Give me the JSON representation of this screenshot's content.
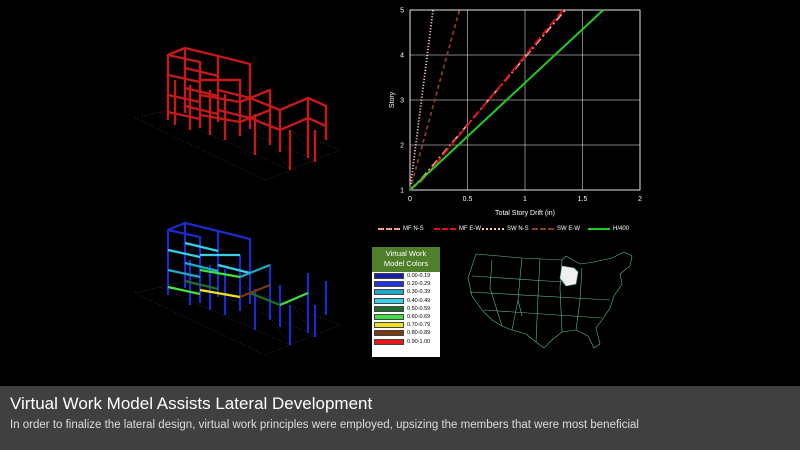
{
  "slide": {
    "title": "Virtual Work Model Assists Lateral Development",
    "subtitle": "In order to finalize the lateral design, virtual work principles were employed, upsizing the members that were most beneficial"
  },
  "chart_data": {
    "type": "line",
    "title": "",
    "xlabel": "Total Story Drift (in)",
    "ylabel": "Story",
    "xlim": [
      0,
      2
    ],
    "ylim": [
      1,
      5
    ],
    "xticks": [
      "0",
      "0.5",
      "1",
      "1.5",
      "2"
    ],
    "yticks": [
      "1",
      "2",
      "3",
      "4",
      "5"
    ],
    "grid": true,
    "legend_position": "bottom",
    "series": [
      {
        "name": "MF N-S",
        "color": "#f4a0a0",
        "style": "dashdot",
        "points": [
          [
            0,
            1
          ],
          [
            0.1,
            1.25
          ],
          [
            1.35,
            5
          ]
        ]
      },
      {
        "name": "MF E-W",
        "color": "#e01010",
        "style": "longdash",
        "points": [
          [
            0,
            1
          ],
          [
            0.1,
            1.2
          ],
          [
            1.33,
            5
          ]
        ]
      },
      {
        "name": "SW N-S",
        "color": "#f6c8b8",
        "style": "dotted",
        "points": [
          [
            0,
            1
          ],
          [
            0.2,
            5
          ]
        ]
      },
      {
        "name": "SW E-W",
        "color": "#8a3a2a",
        "style": "dashed",
        "points": [
          [
            0,
            1
          ],
          [
            0.43,
            5
          ]
        ]
      },
      {
        "name": "H/400",
        "color": "#22cc22",
        "style": "solid",
        "points": [
          [
            0,
            1
          ],
          [
            1.68,
            5
          ]
        ]
      }
    ]
  },
  "virtual_work": {
    "title_line1": "Virtual Work",
    "title_line2": "Model Colors",
    "ranges": [
      {
        "label": "0.00-0.19",
        "color": "#1a1aa0"
      },
      {
        "label": "0.20-0.29",
        "color": "#2233dd"
      },
      {
        "label": "0.30-0.39",
        "color": "#1fa8c8"
      },
      {
        "label": "0.40-0.49",
        "color": "#36d0e8"
      },
      {
        "label": "0.50-0.59",
        "color": "#1f6e2a"
      },
      {
        "label": "0.60-0.69",
        "color": "#3fe040"
      },
      {
        "label": "0.70-0.79",
        "color": "#f0e020"
      },
      {
        "label": "0.80-0.89",
        "color": "#7a3a12"
      },
      {
        "label": "0.90-1.00",
        "color": "#e81818"
      }
    ]
  },
  "colors": {
    "caption_bar": "#404040",
    "frame_red": "#d01818",
    "grid_line": "#ffffff"
  }
}
